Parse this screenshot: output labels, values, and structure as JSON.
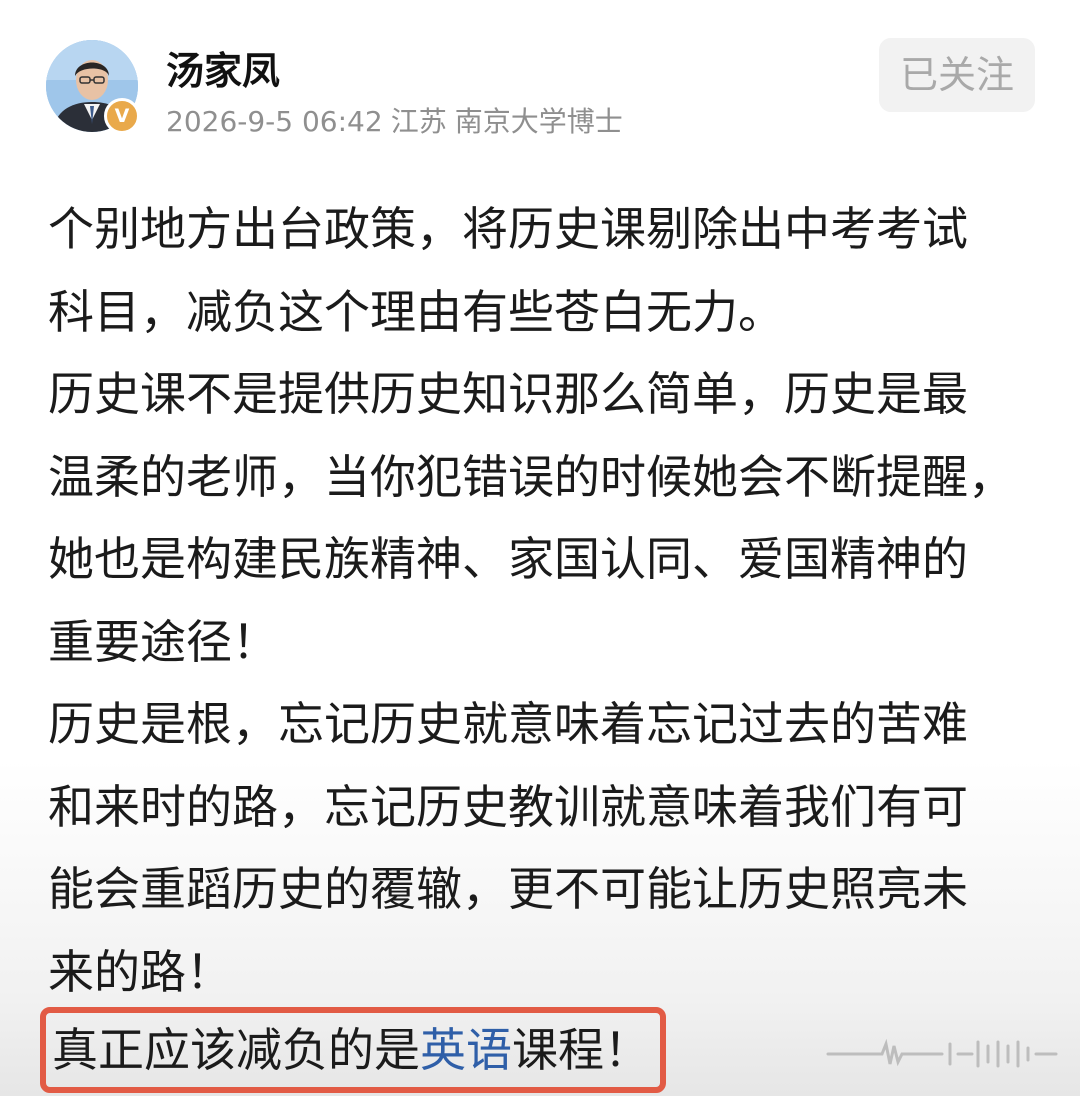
{
  "author": {
    "name": "汤家凤",
    "badge": "V"
  },
  "meta": {
    "timestamp": "2026-9-5 06:42",
    "location": "江苏",
    "title": "南京大学博士"
  },
  "follow_button": {
    "label": "已关注"
  },
  "content": {
    "lines": [
      "个别地方出台政策，将历史课剔除出中考考试",
      "科目，减负这个理由有些苍白无力。",
      "历史课不是提供历史知识那么简单，历史是最",
      "温柔的老师，当你犯错误的时候她会不断提醒，",
      "她也是构建民族精神、家国认同、爱国精神的",
      "重要途径！",
      "历史是根，忘记历史就意味着忘记过去的苦难",
      "和来时的路，忘记历史教训就意味着我们有可",
      "能会重蹈历史的覆辙，更不可能让历史照亮未",
      "来的路！"
    ],
    "highlight": {
      "before": "真正应该减负的是",
      "link": "英语",
      "after": "课程！"
    }
  },
  "colors": {
    "highlight_border": "#e25b45",
    "link": "#2f5fa8",
    "meta_text": "#8f8f8f",
    "badge": "#e9a94b"
  }
}
